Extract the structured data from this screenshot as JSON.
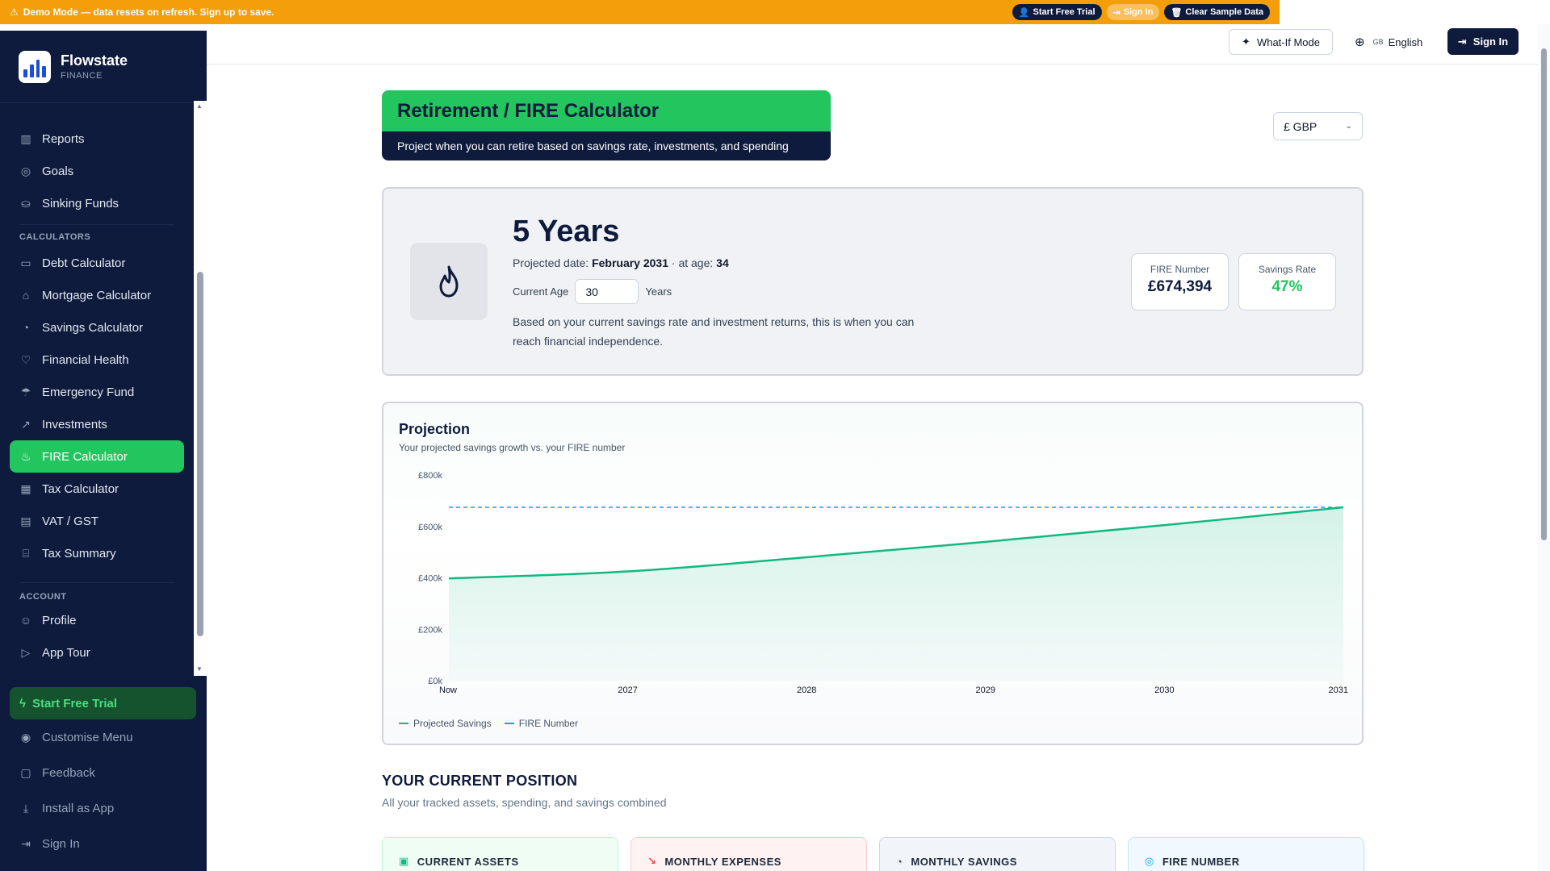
{
  "banner": {
    "text": "Demo Mode — data resets on refresh. Sign up to save.",
    "start_trial": "Start Free Trial",
    "sign_in": "Sign In",
    "clear": "Clear Sample Data"
  },
  "brand": {
    "name": "Flowstate",
    "sub": "FINANCE"
  },
  "sidebar": {
    "items_top": [
      {
        "label": "Reports",
        "icon": "bar-chart-icon"
      },
      {
        "label": "Goals",
        "icon": "target-icon"
      },
      {
        "label": "Sinking Funds",
        "icon": "coins-icon"
      }
    ],
    "section_calculators": "CALCULATORS",
    "calculators": [
      {
        "label": "Debt Calculator",
        "icon": "credit-card-icon"
      },
      {
        "label": "Mortgage Calculator",
        "icon": "home-icon"
      },
      {
        "label": "Savings Calculator",
        "icon": "piggy-bank-icon"
      },
      {
        "label": "Financial Health",
        "icon": "heart-pulse-icon"
      },
      {
        "label": "Emergency Fund",
        "icon": "umbrella-icon"
      },
      {
        "label": "Investments",
        "icon": "trending-up-icon"
      },
      {
        "label": "FIRE Calculator",
        "icon": "flame-icon",
        "active": true
      },
      {
        "label": "Tax Calculator",
        "icon": "calculator-icon"
      },
      {
        "label": "VAT / GST",
        "icon": "receipt-icon"
      },
      {
        "label": "Tax Summary",
        "icon": "landmark-icon"
      }
    ],
    "section_account": "ACCOUNT",
    "account": [
      {
        "label": "Profile",
        "icon": "user-icon"
      },
      {
        "label": "App Tour",
        "icon": "play-circle-icon"
      }
    ],
    "bottom": {
      "trial": "Start Free Trial",
      "customise": "Customise Menu",
      "feedback": "Feedback",
      "install": "Install as App",
      "signin": "Sign In"
    }
  },
  "header": {
    "what_if": "What-If Mode",
    "lang_flag": "GB",
    "language": "English",
    "sign_in": "Sign In"
  },
  "page": {
    "title": "Retirement / FIRE Calculator",
    "subtitle": "Project when you can retire based on savings rate, investments, and spending",
    "currency": "£ GBP"
  },
  "hero": {
    "years": "5 Years",
    "projected_label": "Projected date:",
    "projected_date": "February 2031",
    "age_label": "· at age:",
    "age_value": "34",
    "current_age_label": "Current Age",
    "current_age": "30",
    "years_unit": "Years",
    "description": "Based on your current savings rate and investment returns, this is when you can reach financial independence.",
    "fire_number_label": "FIRE Number",
    "fire_number": "£674,394",
    "savings_rate_label": "Savings Rate",
    "savings_rate": "47%"
  },
  "projection": {
    "title": "Projection",
    "subtitle": "Your projected savings growth vs. your FIRE number"
  },
  "chart_data": {
    "type": "area",
    "x": [
      "Now",
      "2027",
      "2028",
      "2029",
      "2030",
      "2031"
    ],
    "x_tick_labels": [
      "Now",
      "2027",
      "2028",
      "2029",
      "2030",
      "2031"
    ],
    "y_tick_labels": [
      "£0k",
      "£200k",
      "£400k",
      "£600k",
      "£800k"
    ],
    "ylim": [
      0,
      800000
    ],
    "series": [
      {
        "name": "Projected Savings",
        "values": [
          398000,
          425000,
          480000,
          540000,
          605000,
          674394
        ],
        "color": "#10b981"
      },
      {
        "name": "FIRE Number",
        "values": [
          674394,
          674394,
          674394,
          674394,
          674394,
          674394
        ],
        "color": "#0ea5e9",
        "dashed": true
      }
    ],
    "grid": false,
    "legend": "bottom-left"
  },
  "position": {
    "title": "YOUR CURRENT POSITION",
    "subtitle": "All your tracked assets, spending, and savings combined",
    "cards": [
      {
        "label": "CURRENT ASSETS",
        "icon": "wallet-icon",
        "color": "#10b981",
        "bg": "#f0fdf4",
        "border": "#bbf7d0"
      },
      {
        "label": "MONTHLY EXPENSES",
        "icon": "trending-down-icon",
        "color": "#ef4444",
        "bg": "#fef2f2",
        "border": "#fecaca"
      },
      {
        "label": "MONTHLY SAVINGS",
        "icon": "piggy-bank-icon",
        "color": "#334155",
        "bg": "#f1f5f9",
        "border": "#cbd5e1"
      },
      {
        "label": "FIRE NUMBER",
        "icon": "target-icon",
        "color": "#0ea5e9",
        "bg": "#f0f9ff",
        "border": "#bae6fd"
      }
    ]
  }
}
